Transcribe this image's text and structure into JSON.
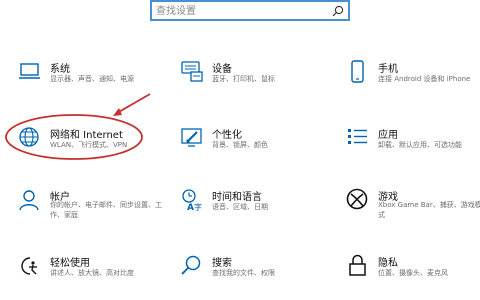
{
  "search": {
    "placeholder": "查找设置",
    "value": ""
  },
  "tiles": [
    {
      "id": "system",
      "title": "系统",
      "desc": "显示器、声音、通知、电源",
      "icon": "laptop-icon"
    },
    {
      "id": "devices",
      "title": "设备",
      "desc": "蓝牙、打印机、鼠标",
      "icon": "keyboard-printer-icon"
    },
    {
      "id": "phone",
      "title": "手机",
      "desc": "连接 Android 设备和 iPhone",
      "icon": "phone-icon"
    },
    {
      "id": "network",
      "title": "网络和 Internet",
      "desc": "WLAN、飞行模式、VPN",
      "icon": "globe-icon"
    },
    {
      "id": "personalization",
      "title": "个性化",
      "desc": "背景、锁屏、颜色",
      "icon": "paintbrush-icon"
    },
    {
      "id": "apps",
      "title": "应用",
      "desc": "卸载、默认应用、可选功能",
      "icon": "apps-list-icon"
    },
    {
      "id": "accounts",
      "title": "帐户",
      "desc": "你的帐户、电子邮件、同步设置、工作、家庭",
      "icon": "person-icon"
    },
    {
      "id": "time-language",
      "title": "时间和语言",
      "desc": "语音、区域、日期",
      "icon": "time-language-icon"
    },
    {
      "id": "gaming",
      "title": "游戏",
      "desc": "Xbox Game Bar、捕获、游戏模式",
      "icon": "xbox-icon"
    },
    {
      "id": "ease-of-access",
      "title": "轻松使用",
      "desc": "讲述人、放大镜、高对比度",
      "icon": "ease-of-access-icon"
    },
    {
      "id": "search",
      "title": "搜索",
      "desc": "查找我的文件、权限",
      "icon": "magnifier-icon"
    },
    {
      "id": "privacy",
      "title": "隐私",
      "desc": "位置、摄像头、麦克风",
      "icon": "lock-icon"
    }
  ],
  "colors": {
    "accent": "#0063b1",
    "annotation": "#c4312c",
    "search_border": "#4a8fd6"
  }
}
